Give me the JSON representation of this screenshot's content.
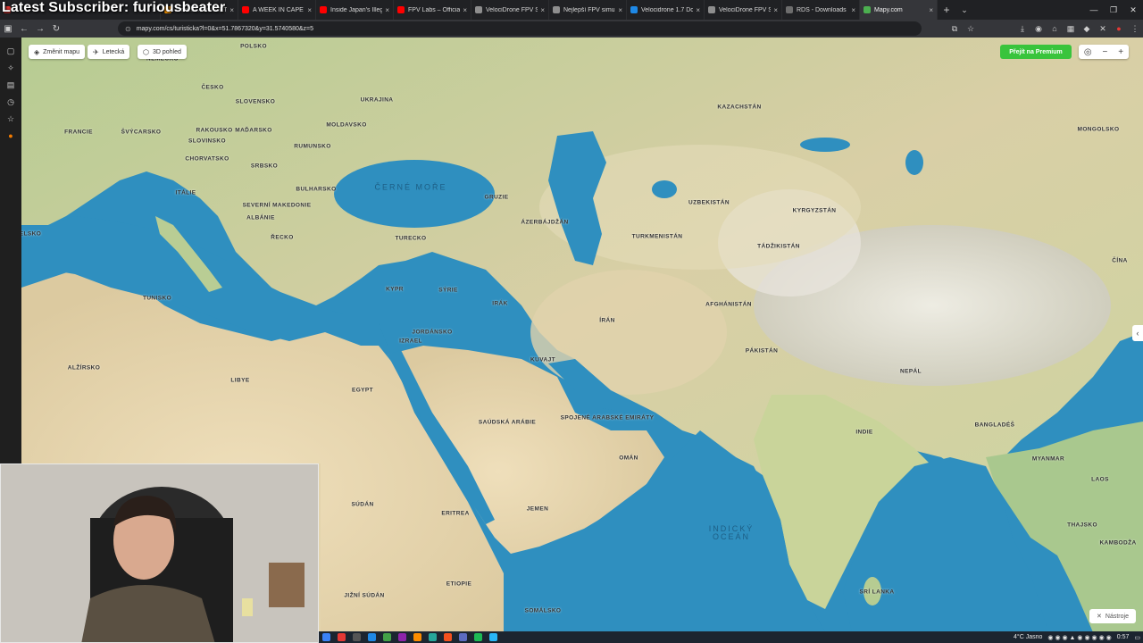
{
  "overlay": {
    "title": "Latest Subscriber: furiousbeater"
  },
  "tabs": [
    {
      "label": "",
      "color": "#e53935"
    },
    {
      "label": "Amazon.com: NETGEAR",
      "color": "#ff9900"
    },
    {
      "label": "A WEEK IN CAPE YORK",
      "color": "#ff0000"
    },
    {
      "label": "Inside Japan's Illegal",
      "color": "#ff0000"
    },
    {
      "label": "FPV Labs – Official Re",
      "color": "#ff0000"
    },
    {
      "label": "VelociDrone FPV Sim",
      "color": "#8e8e8e"
    },
    {
      "label": "Nejlepší FPV simuláto",
      "color": "#8e8e8e"
    },
    {
      "label": "Velocidrone 1.7 Down",
      "color": "#1e88e5"
    },
    {
      "label": "VelociDrone FPV Sim",
      "color": "#8e8e8e"
    },
    {
      "label": "RDS - Downloads",
      "color": "#6d6d6d"
    },
    {
      "label": "Mapy.com",
      "color": "#4caf50",
      "active": true
    }
  ],
  "address_bar": {
    "url": "mapy.com/cs/turisticka?l=0&x=51.7867320&y=31.5740580&z=5"
  },
  "map_controls": {
    "change_map": "Změnit mapu",
    "aerial": "Letecká",
    "view_3d": "3D pohled",
    "premium": "Přejít na Premium",
    "tools": "Nástroje"
  },
  "map_labels": [
    {
      "text": "NĚMECKO"
    },
    {
      "text": "POLSKO"
    },
    {
      "text": "ČESKO"
    },
    {
      "text": "SLOVENSKO"
    },
    {
      "text": "UKRAJINA"
    },
    {
      "text": "FRANCIE"
    },
    {
      "text": "RAKOUSKO"
    },
    {
      "text": "ŠVÝCARSKO"
    },
    {
      "text": "MOLDAVSKO"
    },
    {
      "text": "MAĎARSKO"
    },
    {
      "text": "SLOVINSKO"
    },
    {
      "text": "RUMUNSKO"
    },
    {
      "text": "CHORVATSKO"
    },
    {
      "text": "SRBSKO"
    },
    {
      "text": "ITÁLIE"
    },
    {
      "text": "BULHARSKO"
    },
    {
      "text": "SEVERNÍ MAKEDONIE"
    },
    {
      "text": "ALBÁNIE"
    },
    {
      "text": "ŘECKO"
    },
    {
      "text": "TURECKO"
    },
    {
      "text": "GRUZIE"
    },
    {
      "text": "ÁZERBÁJDŽÁN"
    },
    {
      "text": "KAZACHSTÁN"
    },
    {
      "text": "UZBEKISTÁN"
    },
    {
      "text": "TURKMENISTÁN"
    },
    {
      "text": "KYRGYZSTÁN"
    },
    {
      "text": "MONGOLSKO"
    },
    {
      "text": "TÁDŽIKISTÁN"
    },
    {
      "text": "ČÍNA"
    },
    {
      "text": "AFGHÁNISTÁN"
    },
    {
      "text": "ÍRÁN"
    },
    {
      "text": "IRÁK"
    },
    {
      "text": "SÝRIE"
    },
    {
      "text": "KYPR"
    },
    {
      "text": "TUNISKO"
    },
    {
      "text": "ALŽÍRSKO"
    },
    {
      "text": "LIBYE"
    },
    {
      "text": "EGYPT"
    },
    {
      "text": "IZRAEL"
    },
    {
      "text": "JORDÁNSKO"
    },
    {
      "text": "KUVAJT"
    },
    {
      "text": "SAÚDSKÁ ARÁBIE"
    },
    {
      "text": "SPOJENÉ ARABSKÉ EMIRÁTY"
    },
    {
      "text": "OMÁN"
    },
    {
      "text": "PÁKISTÁN"
    },
    {
      "text": "INDIE"
    },
    {
      "text": "NEPÁL"
    },
    {
      "text": "BANGLADÉŠ"
    },
    {
      "text": "MYANMAR"
    },
    {
      "text": "LAOS"
    },
    {
      "text": "THAJSKO"
    },
    {
      "text": "KAMBODŽA"
    },
    {
      "text": "SÚDÁN"
    },
    {
      "text": "ERITREA"
    },
    {
      "text": "JEMEN"
    },
    {
      "text": "ETIOPIE"
    },
    {
      "text": "JIŽNÍ SÚDÁN"
    },
    {
      "text": "SOMÁLSKO"
    },
    {
      "text": "SRÍ LANKA"
    },
    {
      "text": "ELSKO"
    },
    {
      "text": "ČERNÉ MOŘE",
      "sea": true
    },
    {
      "text": "INDICKÝ\nOCEÁN",
      "sea": true
    }
  ],
  "taskbar": {
    "weather": "4°C Jasno",
    "time": "0:57"
  },
  "colors": {
    "sea": "#2b8ab8",
    "land_desert": "#e8d9b4",
    "land_green": "#b8cf96",
    "premium": "#39c43c"
  }
}
